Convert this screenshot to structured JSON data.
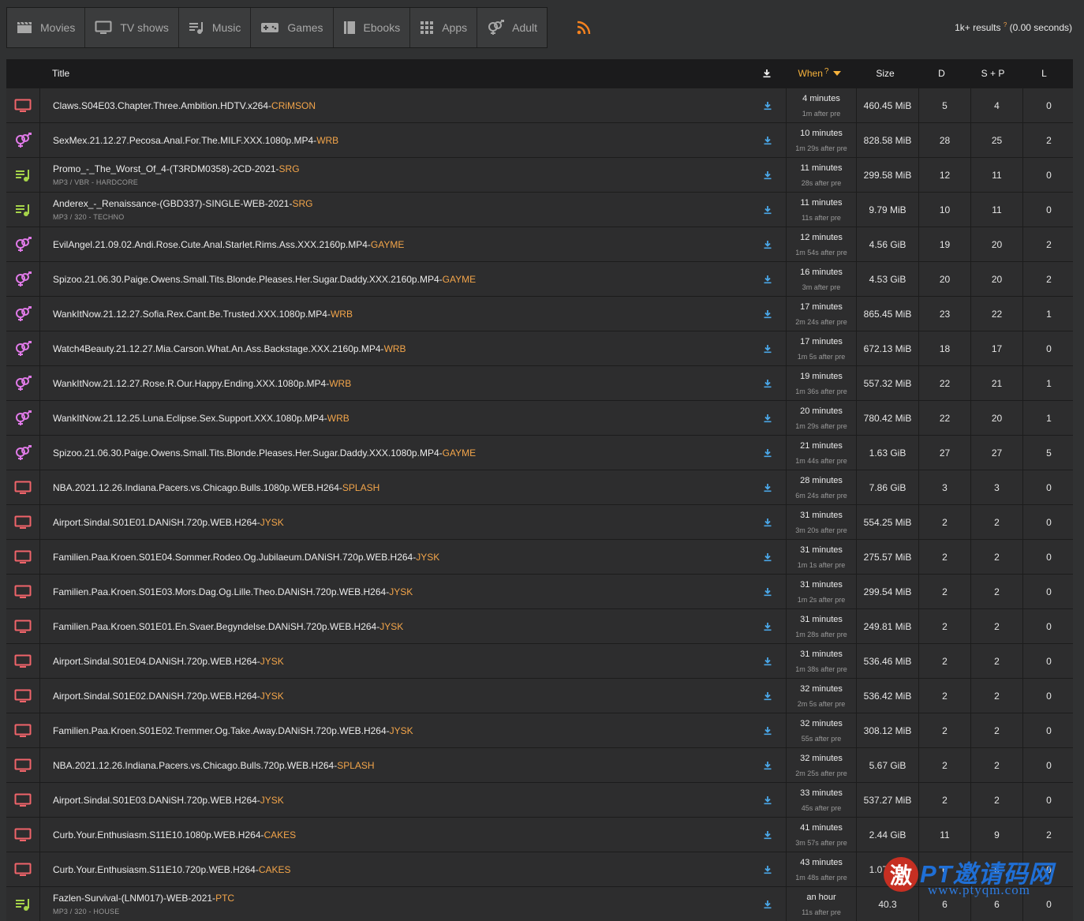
{
  "categories": [
    {
      "label": "Movies",
      "icon": "clapperboard-icon"
    },
    {
      "label": "TV shows",
      "icon": "tv-icon"
    },
    {
      "label": "Music",
      "icon": "music-icon"
    },
    {
      "label": "Games",
      "icon": "gamepad-icon"
    },
    {
      "label": "Ebooks",
      "icon": "book-icon"
    },
    {
      "label": "Apps",
      "icon": "apps-grid-icon"
    },
    {
      "label": "Adult",
      "icon": "gender-icon"
    }
  ],
  "results": {
    "count": "1k+ results",
    "hint": "?",
    "time": "(0.00 seconds)"
  },
  "colors": {
    "accent": "#f3a54a",
    "tv": "#f0646a",
    "adult": "#e07ae8",
    "music": "#a6d44a",
    "download": "#4aa7e8",
    "rss": "#f5821f"
  },
  "columns": {
    "title": "Title",
    "when": "When",
    "when_hint": "?",
    "size": "Size",
    "d": "D",
    "sp": "S + P",
    "l": "L"
  },
  "rows": [
    {
      "type": "tv",
      "name": "Claws.S04E03.Chapter.Three.Ambition.HDTV.x264-",
      "group": "CRiMSON",
      "meta": "",
      "when": "4 minutes",
      "pre": "1m after pre",
      "size": "460.45 MiB",
      "d": "5",
      "sp": "4",
      "l": "0"
    },
    {
      "type": "adult",
      "name": "SexMex.21.12.27.Pecosa.Anal.For.The.MILF.XXX.1080p.MP4-",
      "group": "WRB",
      "meta": "",
      "when": "10 minutes",
      "pre": "1m 29s after pre",
      "size": "828.58 MiB",
      "d": "28",
      "sp": "25",
      "l": "2"
    },
    {
      "type": "music",
      "name": "Promo_-_The_Worst_Of_4-(T3RDM0358)-2CD-2021-",
      "group": "SRG",
      "meta": "MP3 / VBR - HARDCORE",
      "when": "11 minutes",
      "pre": "28s after pre",
      "size": "299.58 MiB",
      "d": "12",
      "sp": "11",
      "l": "0"
    },
    {
      "type": "music",
      "name": "Anderex_-_Renaissance-(GBD337)-SINGLE-WEB-2021-",
      "group": "SRG",
      "meta": "MP3 / 320 - TECHNO",
      "when": "11 minutes",
      "pre": "11s after pre",
      "size": "9.79 MiB",
      "d": "10",
      "sp": "11",
      "l": "0"
    },
    {
      "type": "adult",
      "name": "EvilAngel.21.09.02.Andi.Rose.Cute.Anal.Starlet.Rims.Ass.XXX.2160p.MP4-",
      "group": "GAYME",
      "meta": "",
      "when": "12 minutes",
      "pre": "1m 54s after pre",
      "size": "4.56 GiB",
      "d": "19",
      "sp": "20",
      "l": "2"
    },
    {
      "type": "adult",
      "name": "Spizoo.21.06.30.Paige.Owens.Small.Tits.Blonde.Pleases.Her.Sugar.Daddy.XXX.2160p.MP4-",
      "group": "GAYME",
      "meta": "",
      "when": "16 minutes",
      "pre": "3m after pre",
      "size": "4.53 GiB",
      "d": "20",
      "sp": "20",
      "l": "2"
    },
    {
      "type": "adult",
      "name": "WankItNow.21.12.27.Sofia.Rex.Cant.Be.Trusted.XXX.1080p.MP4-",
      "group": "WRB",
      "meta": "",
      "when": "17 minutes",
      "pre": "2m 24s after pre",
      "size": "865.45 MiB",
      "d": "23",
      "sp": "22",
      "l": "1"
    },
    {
      "type": "adult",
      "name": "Watch4Beauty.21.12.27.Mia.Carson.What.An.Ass.Backstage.XXX.2160p.MP4-",
      "group": "WRB",
      "meta": "",
      "when": "17 minutes",
      "pre": "1m 5s after pre",
      "size": "672.13 MiB",
      "d": "18",
      "sp": "17",
      "l": "0"
    },
    {
      "type": "adult",
      "name": "WankItNow.21.12.27.Rose.R.Our.Happy.Ending.XXX.1080p.MP4-",
      "group": "WRB",
      "meta": "",
      "when": "19 minutes",
      "pre": "1m 36s after pre",
      "size": "557.32 MiB",
      "d": "22",
      "sp": "21",
      "l": "1"
    },
    {
      "type": "adult",
      "name": "WankItNow.21.12.25.Luna.Eclipse.Sex.Support.XXX.1080p.MP4-",
      "group": "WRB",
      "meta": "",
      "when": "20 minutes",
      "pre": "1m 29s after pre",
      "size": "780.42 MiB",
      "d": "22",
      "sp": "20",
      "l": "1"
    },
    {
      "type": "adult",
      "name": "Spizoo.21.06.30.Paige.Owens.Small.Tits.Blonde.Pleases.Her.Sugar.Daddy.XXX.1080p.MP4-",
      "group": "GAYME",
      "meta": "",
      "when": "21 minutes",
      "pre": "1m 44s after pre",
      "size": "1.63 GiB",
      "d": "27",
      "sp": "27",
      "l": "5"
    },
    {
      "type": "tv",
      "name": "NBA.2021.12.26.Indiana.Pacers.vs.Chicago.Bulls.1080p.WEB.H264-",
      "group": "SPLASH",
      "meta": "",
      "when": "28 minutes",
      "pre": "6m 24s after pre",
      "size": "7.86 GiB",
      "d": "3",
      "sp": "3",
      "l": "0"
    },
    {
      "type": "tv",
      "name": "Airport.Sindal.S01E01.DANiSH.720p.WEB.H264-",
      "group": "JYSK",
      "meta": "",
      "when": "31 minutes",
      "pre": "3m 20s after pre",
      "size": "554.25 MiB",
      "d": "2",
      "sp": "2",
      "l": "0"
    },
    {
      "type": "tv",
      "name": "Familien.Paa.Kroen.S01E04.Sommer.Rodeo.Og.Jubilaeum.DANiSH.720p.WEB.H264-",
      "group": "JYSK",
      "meta": "",
      "when": "31 minutes",
      "pre": "1m 1s after pre",
      "size": "275.57 MiB",
      "d": "2",
      "sp": "2",
      "l": "0"
    },
    {
      "type": "tv",
      "name": "Familien.Paa.Kroen.S01E03.Mors.Dag.Og.Lille.Theo.DANiSH.720p.WEB.H264-",
      "group": "JYSK",
      "meta": "",
      "when": "31 minutes",
      "pre": "1m 2s after pre",
      "size": "299.54 MiB",
      "d": "2",
      "sp": "2",
      "l": "0"
    },
    {
      "type": "tv",
      "name": "Familien.Paa.Kroen.S01E01.En.Svaer.Begyndelse.DANiSH.720p.WEB.H264-",
      "group": "JYSK",
      "meta": "",
      "when": "31 minutes",
      "pre": "1m 28s after pre",
      "size": "249.81 MiB",
      "d": "2",
      "sp": "2",
      "l": "0"
    },
    {
      "type": "tv",
      "name": "Airport.Sindal.S01E04.DANiSH.720p.WEB.H264-",
      "group": "JYSK",
      "meta": "",
      "when": "31 minutes",
      "pre": "1m 38s after pre",
      "size": "536.46 MiB",
      "d": "2",
      "sp": "2",
      "l": "0"
    },
    {
      "type": "tv",
      "name": "Airport.Sindal.S01E02.DANiSH.720p.WEB.H264-",
      "group": "JYSK",
      "meta": "",
      "when": "32 minutes",
      "pre": "2m 5s after pre",
      "size": "536.42 MiB",
      "d": "2",
      "sp": "2",
      "l": "0"
    },
    {
      "type": "tv",
      "name": "Familien.Paa.Kroen.S01E02.Tremmer.Og.Take.Away.DANiSH.720p.WEB.H264-",
      "group": "JYSK",
      "meta": "",
      "when": "32 minutes",
      "pre": "55s after pre",
      "size": "308.12 MiB",
      "d": "2",
      "sp": "2",
      "l": "0"
    },
    {
      "type": "tv",
      "name": "NBA.2021.12.26.Indiana.Pacers.vs.Chicago.Bulls.720p.WEB.H264-",
      "group": "SPLASH",
      "meta": "",
      "when": "32 minutes",
      "pre": "2m 25s after pre",
      "size": "5.67 GiB",
      "d": "2",
      "sp": "2",
      "l": "0"
    },
    {
      "type": "tv",
      "name": "Airport.Sindal.S01E03.DANiSH.720p.WEB.H264-",
      "group": "JYSK",
      "meta": "",
      "when": "33 minutes",
      "pre": "45s after pre",
      "size": "537.27 MiB",
      "d": "2",
      "sp": "2",
      "l": "0"
    },
    {
      "type": "tv",
      "name": "Curb.Your.Enthusiasm.S11E10.1080p.WEB.H264-",
      "group": "CAKES",
      "meta": "",
      "when": "41 minutes",
      "pre": "3m 57s after pre",
      "size": "2.44 GiB",
      "d": "11",
      "sp": "9",
      "l": "2"
    },
    {
      "type": "tv",
      "name": "Curb.Your.Enthusiasm.S11E10.720p.WEB.H264-",
      "group": "CAKES",
      "meta": "",
      "when": "43 minutes",
      "pre": "1m 48s after pre",
      "size": "1.07 GiB",
      "d": "6",
      "sp": "5",
      "l": "0"
    },
    {
      "type": "music",
      "name": "Fazlen-Survival-(LNM017)-WEB-2021-",
      "group": "PTC",
      "meta": "MP3 / 320 - HOUSE",
      "when": "an hour",
      "pre": "11s after pre",
      "size": "40.3",
      "d": "6",
      "sp": "6",
      "l": "0"
    }
  ],
  "watermark": {
    "logo": "激",
    "text": "PT邀请码网",
    "url": "www.ptyqm.com"
  }
}
